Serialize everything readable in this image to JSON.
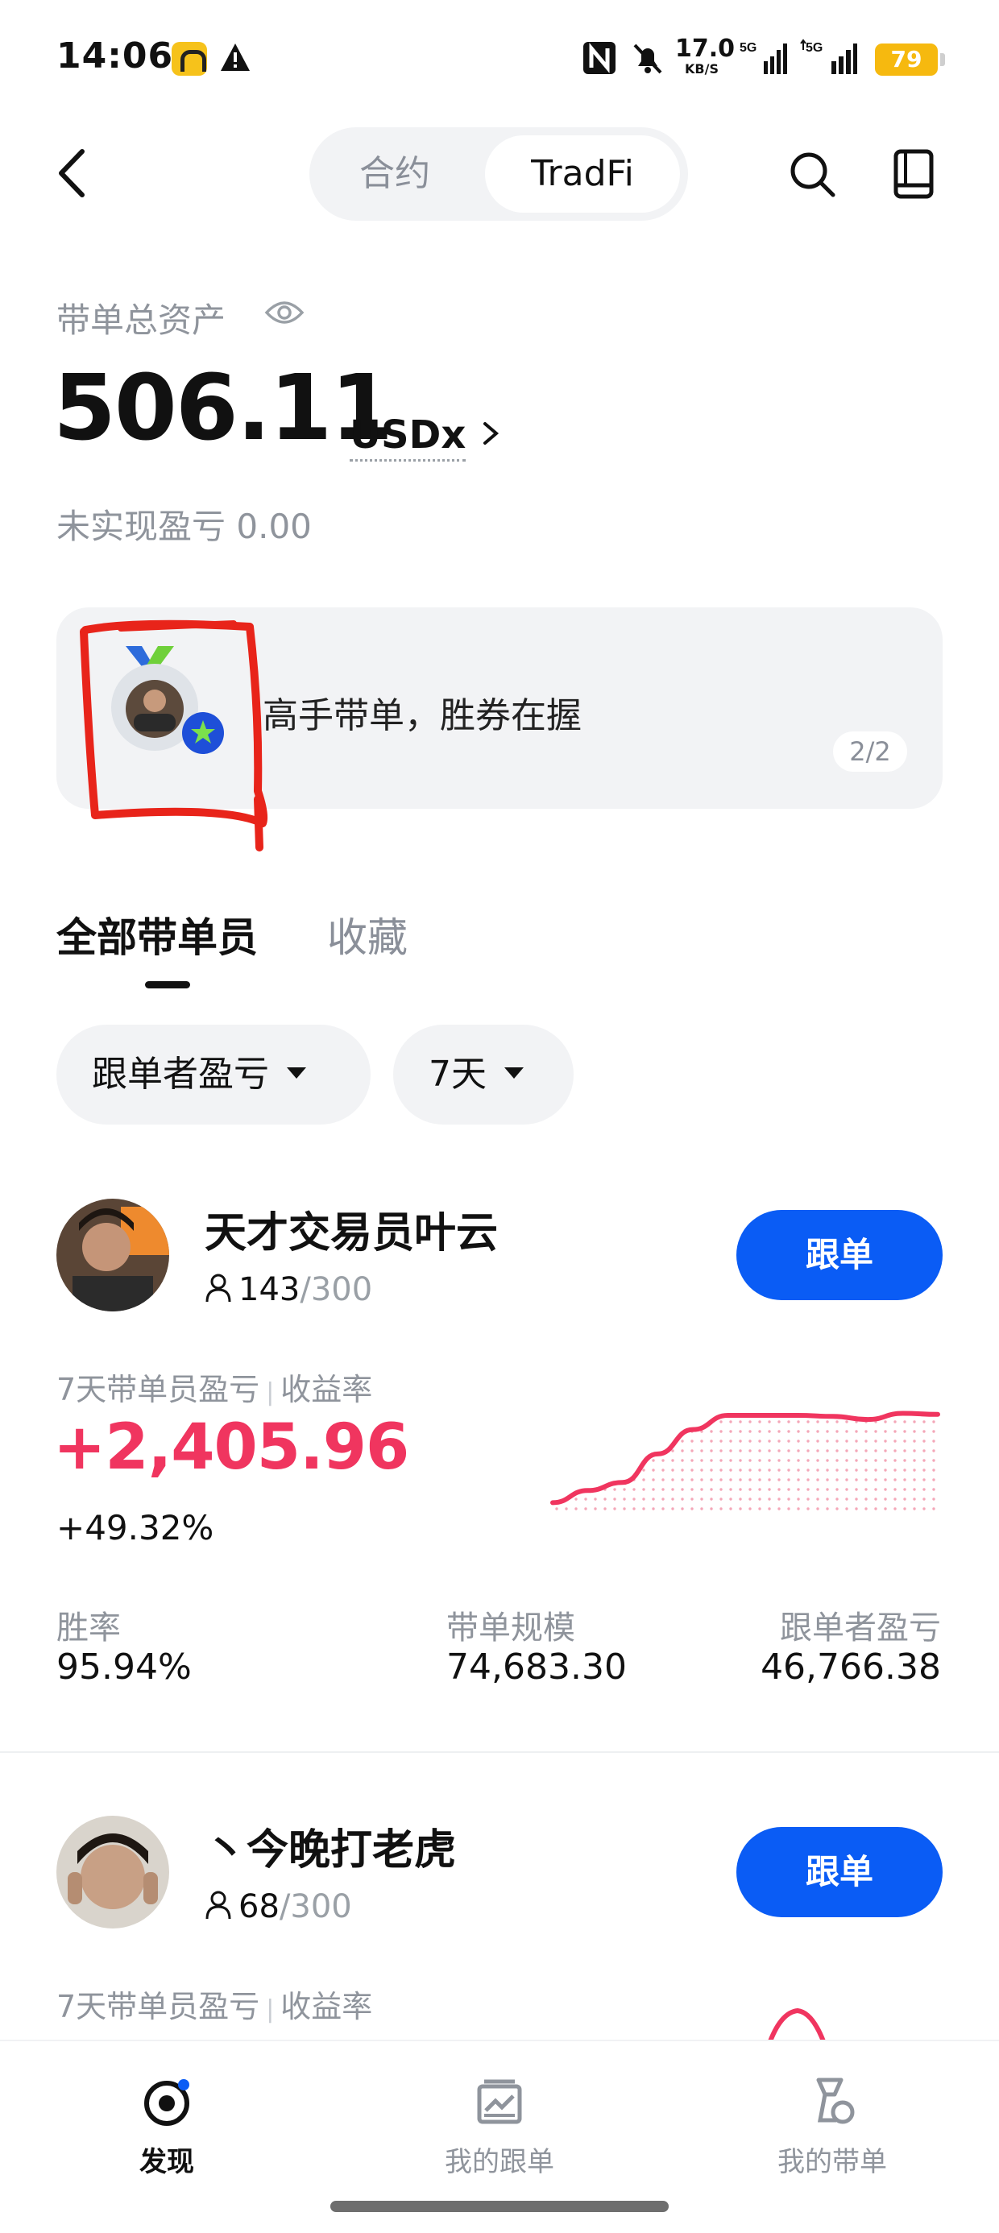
{
  "status_bar": {
    "time": "14:06",
    "net_speed_value": "17.0",
    "net_speed_unit": "KB/S",
    "sig1_label": "5G",
    "sig2_label": "5G",
    "battery": "79",
    "icons": [
      "car-app-icon",
      "warning-icon",
      "nfc-icon",
      "mute-icon",
      "signal-icon",
      "signal-icon",
      "battery-icon"
    ]
  },
  "header": {
    "segments": [
      "合约",
      "TradFi"
    ],
    "active_segment": "TradFi"
  },
  "assets": {
    "label": "带单总资产",
    "value": "506.11",
    "unit": "USDx",
    "unrealized_label": "未实现盈亏",
    "unrealized_value": "0.00"
  },
  "banner": {
    "text": "高手带单，胜券在握",
    "page": "2/2"
  },
  "tabs": [
    "全部带单员",
    "收藏"
  ],
  "filters": [
    {
      "label": "跟单者盈亏"
    },
    {
      "label": "7天"
    }
  ],
  "traders": [
    {
      "name": "天才交易员叶云",
      "followers": "143",
      "followers_max": "/300",
      "follow_label": "跟单",
      "pnl_label": "7天带单员盈亏",
      "rate_label": "收益率",
      "pnl": "+2,405.96",
      "rate": "+49.32%",
      "stats": [
        {
          "label": "胜率",
          "value": "95.94%"
        },
        {
          "label": "带单规模",
          "value": "74,683.30"
        },
        {
          "label": "跟单者盈亏",
          "value": "46,766.38"
        }
      ]
    },
    {
      "name": "丶今晚打老虎",
      "followers": "68",
      "followers_max": "/300",
      "follow_label": "跟单",
      "pnl_label": "7天带单员盈亏",
      "rate_label": "收益率"
    }
  ],
  "chart_data": {
    "type": "area",
    "values": [
      0.1,
      0.22,
      0.3,
      0.58,
      0.82,
      0.96,
      0.96,
      0.96,
      0.95,
      0.92,
      0.98,
      0.97
    ],
    "color": "#f0355f"
  },
  "bottom_nav": [
    {
      "label": "发现",
      "icon": "discover-icon",
      "active": true
    },
    {
      "label": "我的跟单",
      "icon": "my-copy-trades-icon",
      "active": false
    },
    {
      "label": "我的带单",
      "icon": "my-lead-trades-icon",
      "active": false
    }
  ],
  "colors": {
    "accent": "#0a5cf5",
    "profit": "#f0355f",
    "annotation": "#e8241a"
  }
}
